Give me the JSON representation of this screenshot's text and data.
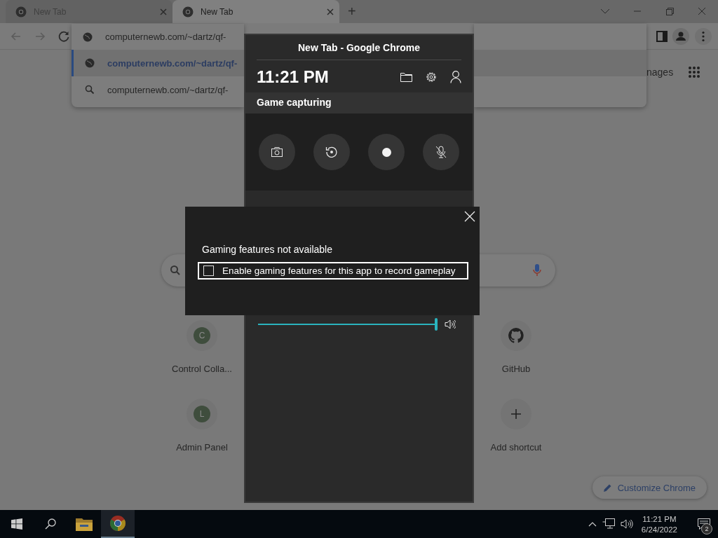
{
  "browser": {
    "tabs": [
      {
        "title": "New Tab",
        "selected": false
      },
      {
        "title": "New Tab",
        "selected": true
      }
    ],
    "new_tab_button": "+",
    "address_bar": {
      "value": "computernewb.com/~dartz/qf-"
    },
    "suggestions": [
      {
        "kind": "url",
        "text": "computernewb.com/~dartz/qf-",
        "selected": true
      },
      {
        "kind": "search",
        "text": "computernewb.com/~dartz/qf-",
        "selected": false
      }
    ],
    "header_link": "nages",
    "shortcuts": [
      {
        "kind": "letter",
        "letter": "C",
        "label": "Control Colla..."
      },
      {
        "kind": "github",
        "label": "GitHub"
      },
      {
        "kind": "letter",
        "letter": "L",
        "label": "Admin Panel"
      },
      {
        "kind": "add",
        "label": "Add shortcut"
      }
    ],
    "customize_button": "Customize Chrome"
  },
  "game_bar": {
    "title": "New Tab - Google Chrome",
    "time": "11:21 PM",
    "section": "Game capturing",
    "capture_buttons": [
      {
        "kind": "screenshot"
      },
      {
        "kind": "replay"
      },
      {
        "kind": "record"
      },
      {
        "kind": "mic-off"
      }
    ],
    "volume": {
      "level": 1
    }
  },
  "dialog": {
    "heading": "Gaming features not available",
    "checkbox": {
      "label": "Enable gaming features for this app to record gameplay",
      "checked": false
    }
  },
  "taskbar": {
    "apps": [
      {
        "kind": "explorer",
        "selected": false
      },
      {
        "kind": "chrome",
        "selected": true
      }
    ],
    "time": "11:21 PM",
    "date": "6/24/2022",
    "notification_count": "2"
  }
}
